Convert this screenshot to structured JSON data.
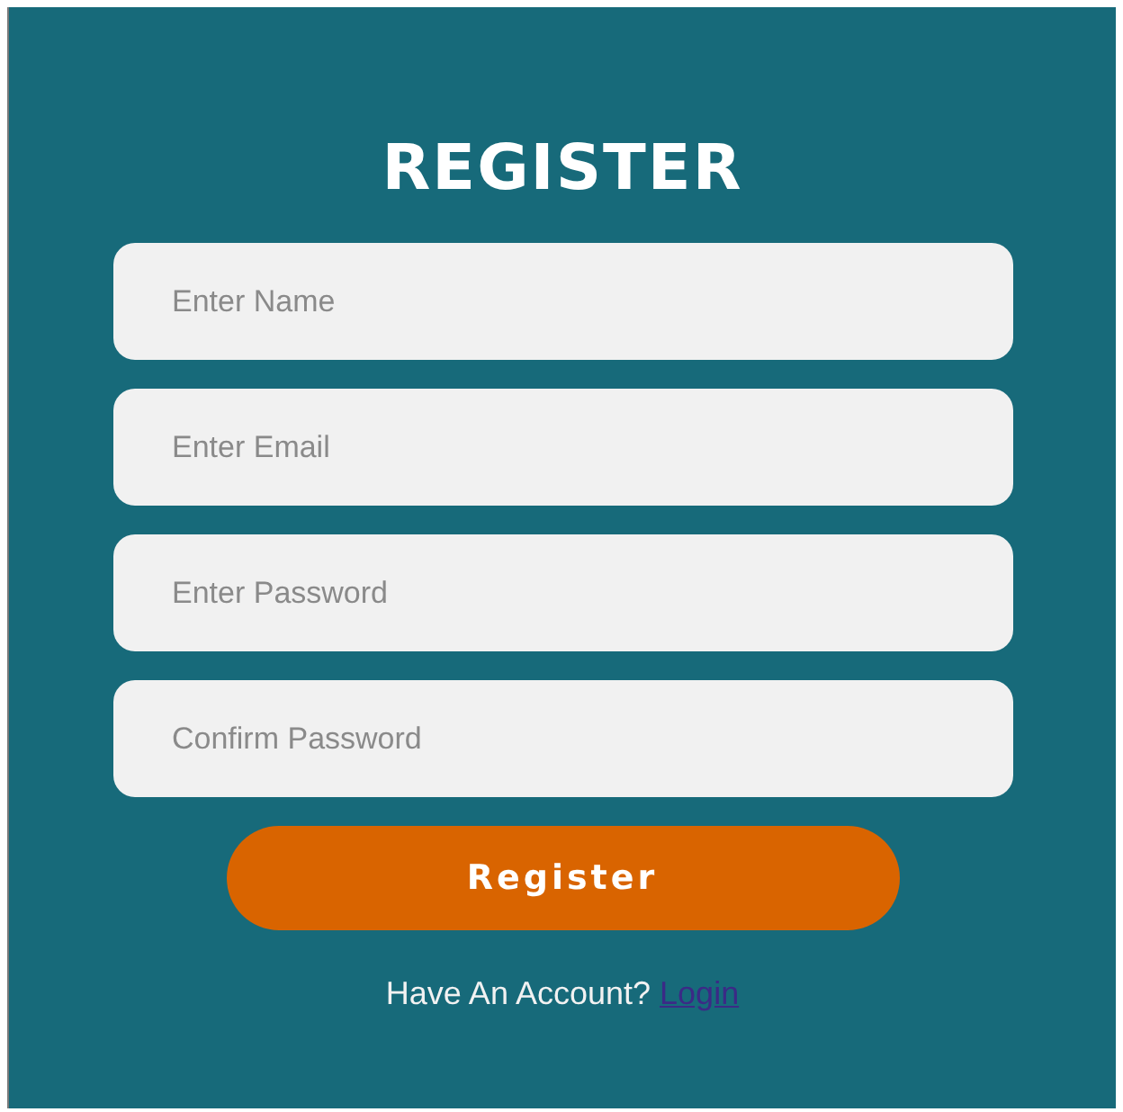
{
  "title": "REGISTER",
  "fields": [
    {
      "placeholder": "Enter Name"
    },
    {
      "placeholder": "Enter Email"
    },
    {
      "placeholder": "Enter Password"
    },
    {
      "placeholder": "Confirm Password"
    }
  ],
  "submit": "Register",
  "footer": {
    "prompt": "Have An Account?",
    "link": "Login"
  }
}
